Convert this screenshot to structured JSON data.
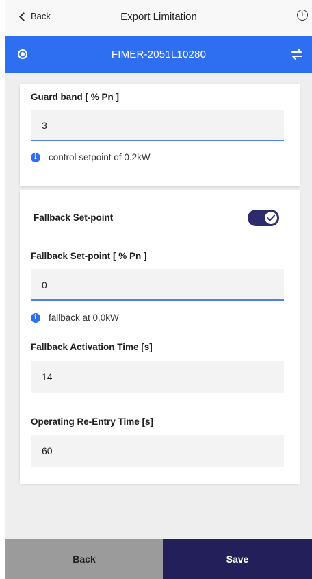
{
  "header": {
    "back_label": "Back",
    "title": "Export Limitation",
    "info_icon": "info-icon"
  },
  "device": {
    "name": "FIMER-2051L10280",
    "status_icon": "device-status-icon",
    "switch_icon": "swap-arrows-icon"
  },
  "guard_band": {
    "label": "Guard band [ % Pn ]",
    "value": "3",
    "hint": "control setpoint of 0.2kW"
  },
  "fallback": {
    "toggle_label": "Fallback Set-point",
    "toggle_on": true,
    "setpoint_label": "Fallback Set-point [ % Pn ]",
    "setpoint_value": "0",
    "setpoint_hint": "fallback at 0.0kW",
    "activation_label": "Fallback Activation Time [s]",
    "activation_value": "14",
    "reentry_label": "Operating Re-Entry Time [s]",
    "reentry_value": "60"
  },
  "footer": {
    "back_button": "Back",
    "save_button": "Save"
  },
  "colors": {
    "accent_blue": "#2e6ef0",
    "toggle_on": "#2d2a6e",
    "save_button": "#231f5b",
    "back_button": "#9b9b9b"
  }
}
